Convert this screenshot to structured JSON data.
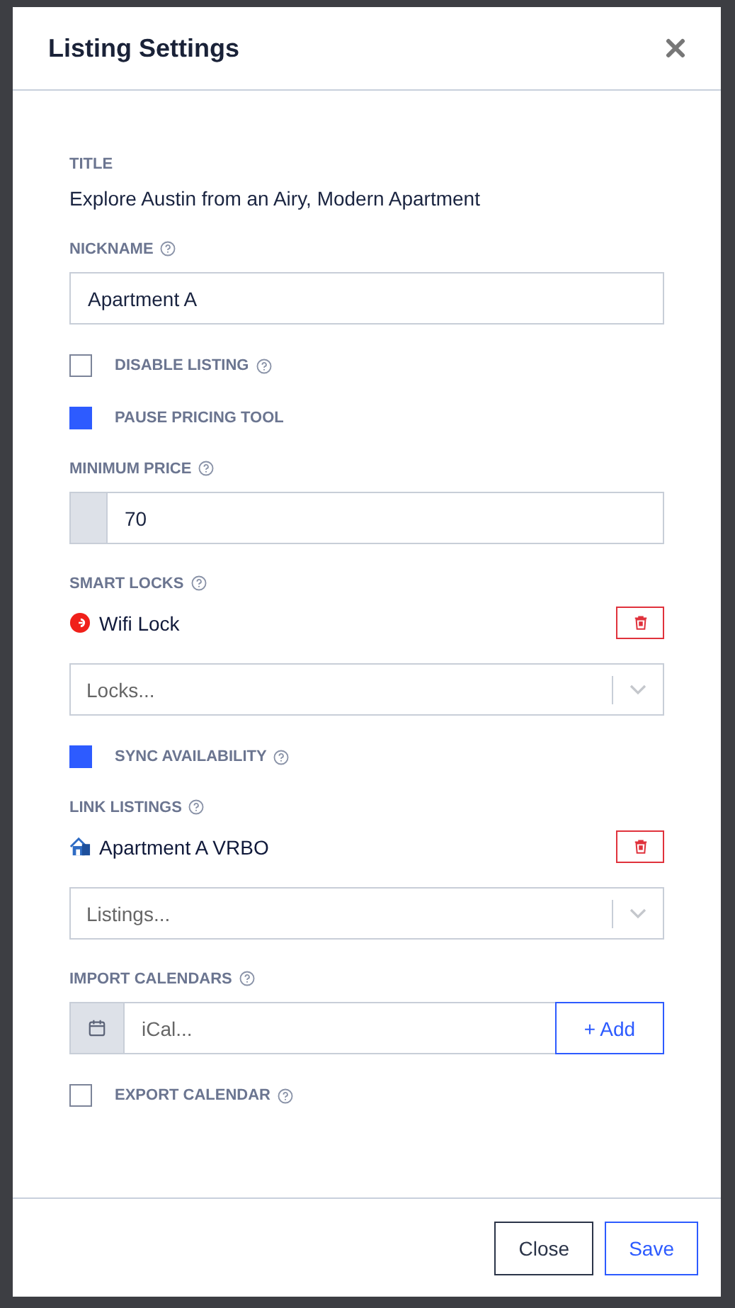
{
  "dialog": {
    "title": "Listing Settings"
  },
  "fields": [
    {
      "kind": "text",
      "label": "TITLE",
      "value": "Explore Austin from an Airy, Modern Apartment"
    },
    {
      "kind": "input",
      "label": "NICKNAME",
      "help": true,
      "value": "Apartment A"
    },
    {
      "kind": "checkbox",
      "label": "DISABLE LISTING",
      "help": true,
      "checked": false
    },
    {
      "kind": "checkbox",
      "label": "PAUSE PRICING TOOL",
      "checked": true
    },
    {
      "kind": "addon_input",
      "label": "MINIMUM PRICE",
      "help": true,
      "value": "70"
    },
    {
      "kind": "linked",
      "label": "SMART LOCKS",
      "help": true,
      "item": {
        "kind": "lock",
        "name": "Wifi Lock"
      },
      "placeholder": "Locks..."
    },
    {
      "kind": "checkbox",
      "label": "SYNC AVAILABILITY",
      "help": true,
      "checked": true
    },
    {
      "kind": "linked",
      "label": "LINK LISTINGS",
      "help": true,
      "item": {
        "kind": "house",
        "name": "Apartment A VRBO"
      },
      "placeholder": "Listings..."
    },
    {
      "kind": "calendar_input",
      "label": "IMPORT CALENDARS",
      "help": true,
      "placeholder": "iCal...",
      "button": "+ Add"
    },
    {
      "kind": "checkbox",
      "label": "EXPORT CALENDAR",
      "help": true,
      "checked": false
    }
  ],
  "buttons": [
    {
      "label": "Close",
      "kind": "secondary"
    },
    {
      "label": "Save",
      "kind": "primary"
    }
  ]
}
